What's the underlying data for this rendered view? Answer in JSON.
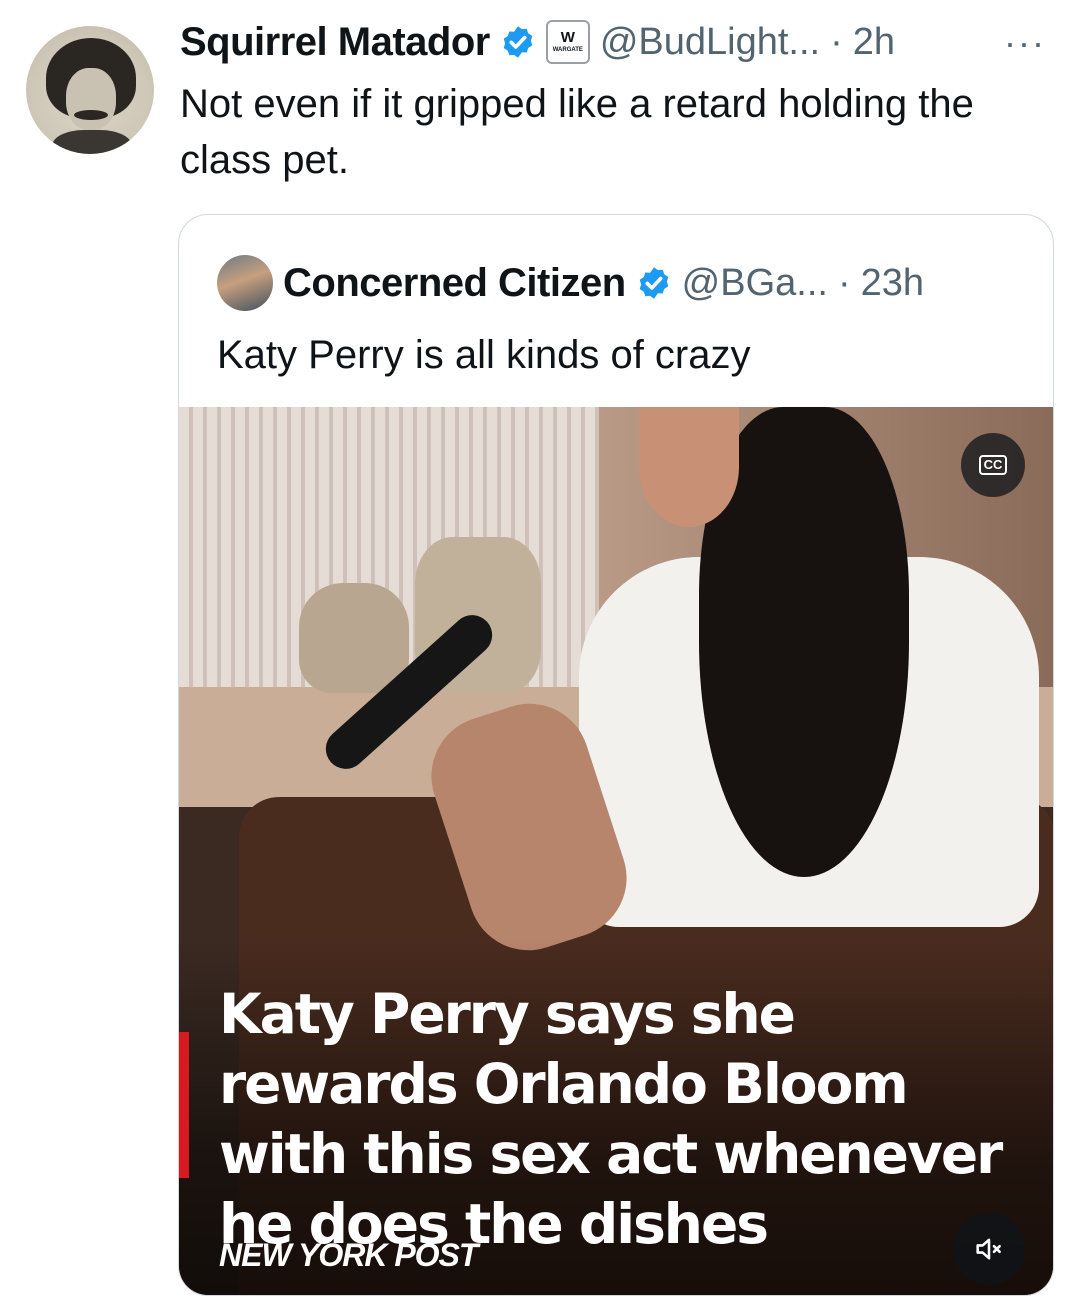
{
  "tweet": {
    "author_name": "Squirrel Matador",
    "handle": "@BudLight...",
    "separator": "·",
    "time": "2h",
    "more_label": "···",
    "badge_text": "W",
    "badge_small": "WARGATE",
    "text": "Not even if it gripped like a retard holding the class pet."
  },
  "quote": {
    "author_name": "Concerned Citizen",
    "handle": "@BGa...",
    "separator": "·",
    "time": "23h",
    "text": "Katy Perry is all kinds of crazy",
    "media": {
      "headline": "Katy Perry says she rewards Orlando Bloom with this sex act whenever he does the dishes",
      "brand": "NEW YORK POST",
      "cc_label": "CC"
    }
  },
  "colors": {
    "verified": "#1d9bf0",
    "secondary_text": "#536471",
    "brand_red": "#d71920"
  }
}
